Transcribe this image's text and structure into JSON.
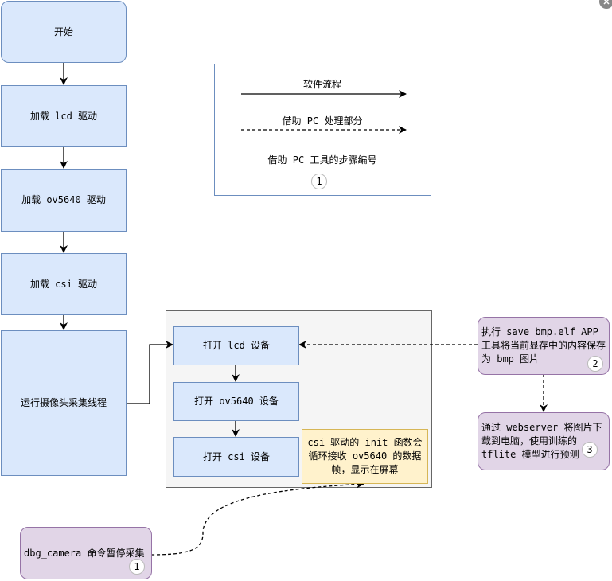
{
  "flow": {
    "start": "开始",
    "lcd": "加载 lcd 驱动",
    "ov": "加载 ov5640 驱动",
    "csi": "加载 csi 驱动",
    "thread": "运行摄像头采集线程"
  },
  "legend": {
    "solid": "软件流程",
    "dashed": "借助 PC 处理部分",
    "step": "借助 PC 工具的步骤编号",
    "step_num": "1"
  },
  "group": {
    "open_lcd": "打开 lcd 设备",
    "open_ov": "打开 ov5640 设备",
    "open_csi": "打开 csi 设备",
    "note": "csi 驱动的 init 函数会循环接收 ov5640 的数据帧，显示在屏幕"
  },
  "pc": {
    "save": "执行 save_bmp.elf APP 工具将当前显存中的内容保存为 bmp 图片",
    "save_num": "2",
    "predict": "通过 webserver 将图片下载到电脑，使用训练的 tflite 模型进行预测",
    "predict_num": "3"
  },
  "dbg": {
    "text": "dbg_camera 命令暂停采集",
    "num": "1"
  },
  "colors": {
    "blue_fill": "#dae8fc",
    "blue_stroke": "#6c8ebf",
    "purple_fill": "#e1d5e7",
    "purple_stroke": "#9673a6",
    "note_fill": "#fff2cc",
    "note_stroke": "#d6b656",
    "group_fill": "#f5f5f5"
  }
}
